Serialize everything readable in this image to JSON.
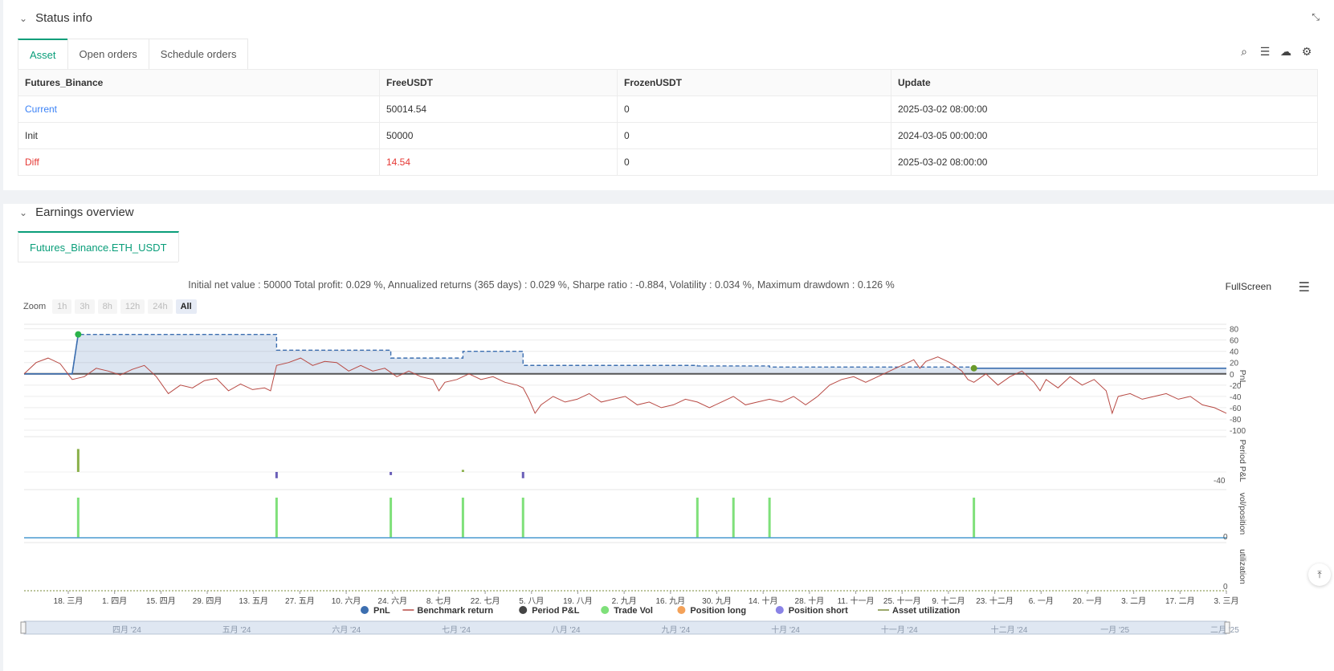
{
  "status_panel": {
    "title": "Status info",
    "tabs": [
      "Asset",
      "Open orders",
      "Schedule orders"
    ],
    "table": {
      "headers": [
        "Futures_Binance",
        "FreeUSDT",
        "FrozenUSDT",
        "Update"
      ],
      "rows": [
        [
          "Current",
          "50014.54",
          "0",
          "2025-03-02 08:00:00"
        ],
        [
          "Init",
          "50000",
          "0",
          "2024-03-05 00:00:00"
        ],
        [
          "Diff",
          "14.54",
          "0",
          "2025-03-02 08:00:00"
        ]
      ]
    }
  },
  "earnings_panel": {
    "title": "Earnings overview",
    "tab": "Futures_Binance.ETH_USDT",
    "summary": "Initial net value : 50000 Total profit: 0.029 %, Annualized returns (365 days) : 0.029 %, Sharpe ratio : -0.884, Volatility : 0.034 %, Maximum drawdown : 0.126 %",
    "fullscreen": "FullScreen",
    "zoom": {
      "label": "Zoom",
      "buttons": [
        "1h",
        "3h",
        "8h",
        "12h",
        "24h",
        "All"
      ],
      "active": "All"
    }
  },
  "chart_data": {
    "type": "line",
    "x_ticks": [
      "18. 三月",
      "1. 四月",
      "15. 四月",
      "29. 四月",
      "13. 五月",
      "27. 五月",
      "10. 六月",
      "24. 六月",
      "8. 七月",
      "22. 七月",
      "5. 八月",
      "19. 八月",
      "2. 九月",
      "16. 九月",
      "30. 九月",
      "14. 十月",
      "28. 十月",
      "11. 十一月",
      "25. 十一月",
      "9. 十二月",
      "23. 十二月",
      "6. 一月",
      "20. 一月",
      "3. 二月",
      "17. 二月",
      "3. 三月"
    ],
    "navigator_ticks": [
      "四月 '24",
      "五月 '24",
      "六月 '24",
      "七月 '24",
      "八月 '24",
      "九月 '24",
      "十月 '24",
      "十一月 '24",
      "十二月 '24",
      "一月 '25",
      "二月 '25"
    ],
    "pnl_axis": {
      "label": "PnL",
      "ticks": [
        80,
        60,
        40,
        20,
        0,
        -20,
        -40,
        -60,
        -80,
        -100
      ],
      "ylim": [
        -100,
        88
      ]
    },
    "period_axis": {
      "label": "Period P&L",
      "ticks": [
        -40
      ]
    },
    "vol_axis": {
      "label": "vol/position",
      "ticks": [
        0
      ]
    },
    "util_axis": {
      "label": "utilization",
      "ticks": [
        0
      ]
    },
    "pnl_series": {
      "name": "PnL",
      "color": "#3d6fb0",
      "points": [
        [
          0,
          0
        ],
        [
          0.04,
          0
        ],
        [
          0.045,
          70
        ],
        [
          0.21,
          70
        ],
        [
          0.21,
          42
        ],
        [
          0.305,
          42
        ],
        [
          0.305,
          28
        ],
        [
          0.365,
          28
        ],
        [
          0.365,
          40
        ],
        [
          0.415,
          40
        ],
        [
          0.415,
          15
        ],
        [
          0.56,
          15
        ],
        [
          0.56,
          14
        ],
        [
          0.62,
          14
        ],
        [
          0.62,
          12
        ],
        [
          0.79,
          12
        ],
        [
          0.79,
          10
        ],
        [
          1,
          10
        ]
      ]
    },
    "drawdown_series": {
      "color": "#3d6fb0",
      "points": [
        [
          0,
          0
        ],
        [
          0.04,
          0
        ],
        [
          0.045,
          70
        ],
        [
          0.21,
          70
        ],
        [
          0.21,
          42
        ],
        [
          0.305,
          42
        ],
        [
          0.305,
          28
        ],
        [
          0.365,
          28
        ],
        [
          0.365,
          40
        ],
        [
          0.415,
          40
        ],
        [
          0.415,
          15
        ],
        [
          0.56,
          15
        ],
        [
          0.56,
          14
        ],
        [
          0.62,
          14
        ],
        [
          0.62,
          12
        ],
        [
          0.79,
          12
        ],
        [
          0.79,
          10
        ],
        [
          1,
          10
        ]
      ]
    },
    "benchmark_series": {
      "name": "Benchmark return",
      "color": "#b84a44",
      "points": [
        [
          0,
          0
        ],
        [
          0.01,
          20
        ],
        [
          0.02,
          28
        ],
        [
          0.03,
          18
        ],
        [
          0.04,
          -10
        ],
        [
          0.05,
          -5
        ],
        [
          0.06,
          10
        ],
        [
          0.07,
          5
        ],
        [
          0.08,
          -2
        ],
        [
          0.09,
          8
        ],
        [
          0.1,
          15
        ],
        [
          0.11,
          -5
        ],
        [
          0.12,
          -35
        ],
        [
          0.13,
          -20
        ],
        [
          0.14,
          -25
        ],
        [
          0.15,
          -12
        ],
        [
          0.16,
          -8
        ],
        [
          0.17,
          -30
        ],
        [
          0.18,
          -18
        ],
        [
          0.19,
          -28
        ],
        [
          0.2,
          -25
        ],
        [
          0.205,
          -30
        ],
        [
          0.21,
          15
        ],
        [
          0.22,
          20
        ],
        [
          0.23,
          28
        ],
        [
          0.24,
          15
        ],
        [
          0.25,
          22
        ],
        [
          0.26,
          20
        ],
        [
          0.27,
          5
        ],
        [
          0.28,
          15
        ],
        [
          0.29,
          5
        ],
        [
          0.3,
          10
        ],
        [
          0.31,
          -5
        ],
        [
          0.32,
          5
        ],
        [
          0.33,
          -5
        ],
        [
          0.34,
          -10
        ],
        [
          0.345,
          -30
        ],
        [
          0.35,
          -15
        ],
        [
          0.36,
          -10
        ],
        [
          0.37,
          0
        ],
        [
          0.38,
          -10
        ],
        [
          0.39,
          -5
        ],
        [
          0.4,
          -15
        ],
        [
          0.41,
          -20
        ],
        [
          0.415,
          -25
        ],
        [
          0.42,
          -45
        ],
        [
          0.425,
          -70
        ],
        [
          0.43,
          -55
        ],
        [
          0.44,
          -40
        ],
        [
          0.45,
          -50
        ],
        [
          0.46,
          -45
        ],
        [
          0.47,
          -35
        ],
        [
          0.48,
          -50
        ],
        [
          0.49,
          -45
        ],
        [
          0.5,
          -40
        ],
        [
          0.51,
          -55
        ],
        [
          0.52,
          -50
        ],
        [
          0.53,
          -60
        ],
        [
          0.54,
          -55
        ],
        [
          0.55,
          -45
        ],
        [
          0.56,
          -50
        ],
        [
          0.57,
          -60
        ],
        [
          0.58,
          -50
        ],
        [
          0.59,
          -40
        ],
        [
          0.6,
          -55
        ],
        [
          0.61,
          -50
        ],
        [
          0.62,
          -45
        ],
        [
          0.63,
          -50
        ],
        [
          0.64,
          -40
        ],
        [
          0.65,
          -55
        ],
        [
          0.66,
          -40
        ],
        [
          0.67,
          -20
        ],
        [
          0.68,
          -10
        ],
        [
          0.69,
          -5
        ],
        [
          0.7,
          -15
        ],
        [
          0.71,
          -5
        ],
        [
          0.72,
          5
        ],
        [
          0.73,
          15
        ],
        [
          0.74,
          25
        ],
        [
          0.745,
          10
        ],
        [
          0.75,
          22
        ],
        [
          0.76,
          30
        ],
        [
          0.77,
          20
        ],
        [
          0.78,
          5
        ],
        [
          0.785,
          -10
        ],
        [
          0.79,
          -15
        ],
        [
          0.8,
          0
        ],
        [
          0.81,
          -20
        ],
        [
          0.82,
          -5
        ],
        [
          0.83,
          5
        ],
        [
          0.84,
          -15
        ],
        [
          0.845,
          -30
        ],
        [
          0.85,
          -10
        ],
        [
          0.86,
          -25
        ],
        [
          0.87,
          -5
        ],
        [
          0.88,
          -20
        ],
        [
          0.89,
          -10
        ],
        [
          0.9,
          -30
        ],
        [
          0.905,
          -70
        ],
        [
          0.91,
          -40
        ],
        [
          0.92,
          -35
        ],
        [
          0.93,
          -45
        ],
        [
          0.94,
          -40
        ],
        [
          0.95,
          -35
        ],
        [
          0.96,
          -45
        ],
        [
          0.97,
          -40
        ],
        [
          0.98,
          -55
        ],
        [
          0.99,
          -60
        ],
        [
          1,
          -70
        ]
      ]
    },
    "trade_markers": [
      0.045,
      0.79
    ],
    "period_pnl_bars": [
      [
        0.045,
        22
      ],
      [
        0.21,
        -6
      ],
      [
        0.305,
        -3
      ],
      [
        0.365,
        2
      ],
      [
        0.415,
        -6
      ]
    ],
    "trade_vol_bars": [
      0.045,
      0.21,
      0.305,
      0.365,
      0.415,
      0.56,
      0.59,
      0.62,
      0.79
    ],
    "legend": [
      {
        "name": "PnL",
        "color": "#3d6fb0",
        "type": "dot"
      },
      {
        "name": "Benchmark return",
        "color": "#b84a44",
        "type": "line"
      },
      {
        "name": "Period P&L",
        "color": "#444444",
        "type": "dot"
      },
      {
        "name": "Trade Vol",
        "color": "#7fe07a",
        "type": "dot"
      },
      {
        "name": "Position long",
        "color": "#f4a259",
        "type": "dot"
      },
      {
        "name": "Position short",
        "color": "#8a83e6",
        "type": "dot"
      },
      {
        "name": "Asset utilization",
        "color": "#7a8a3a",
        "type": "line"
      }
    ]
  }
}
